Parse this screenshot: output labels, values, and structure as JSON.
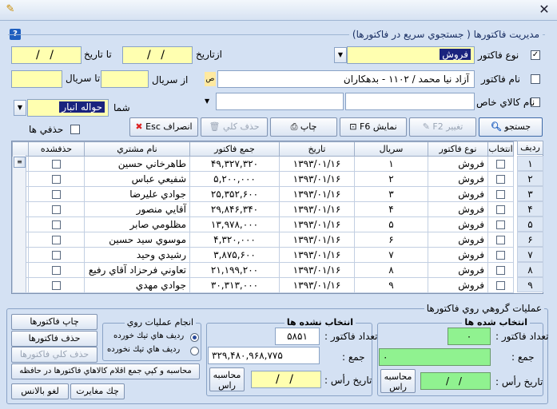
{
  "window": {
    "close_glyph": "✕"
  },
  "filter": {
    "group_title": "مديريت فاكتورها ( جستجوي سريع در فاكتورها)",
    "invoice_type_label": "نوع فاكتور",
    "invoice_type_value": "فروش",
    "invoice_type_checked": true,
    "from_date_label": "ازتاريخ",
    "to_date_label": "تا تاريخ",
    "from_date_value": "/ /",
    "to_date_value": "/ /",
    "customer_name_label": "نام فاكتور",
    "customer_name_value": "آزاد نيا محمد / ۱۱۰۲ - بدهكاران",
    "from_serial_label": "از سريال",
    "to_serial_label": "تا سريال",
    "special_goods_label": "نام كالاي خاص",
    "shipping_label": "شما",
    "shipping_value": "حواله انبار",
    "deleted_label": "حذفي ها"
  },
  "toolbar": {
    "search": "جستجو",
    "edit": "تغيير F2",
    "show": "نمايش F6",
    "print": "چاپ",
    "delete_all": "حذف كلي",
    "cancel": "انصراف Esc"
  },
  "grid": {
    "columns": [
      "رديف",
      "انتخاب",
      "نوع فاكتور",
      "سريال",
      "تاريخ",
      "جمع فاكتور",
      "نام مشتري",
      "حذفشده"
    ],
    "rows": [
      {
        "row": "۱",
        "type": "فروش",
        "serial": "۱",
        "date": "۱۳۹۳/۰۱/۱۶",
        "total": "۴۹,۳۲۷,۳۲۰",
        "customer": "طاهرخاني حسين"
      },
      {
        "row": "۲",
        "type": "فروش",
        "serial": "۲",
        "date": "۱۳۹۳/۰۱/۱۶",
        "total": "۵,۲۰۰,۰۰۰",
        "customer": "شفيعي عباس"
      },
      {
        "row": "۳",
        "type": "فروش",
        "serial": "۳",
        "date": "۱۳۹۳/۰۱/۱۶",
        "total": "۲۵,۳۵۲,۶۰۰",
        "customer": "جوادي عليرضا"
      },
      {
        "row": "۴",
        "type": "فروش",
        "serial": "۴",
        "date": "۱۳۹۳/۰۱/۱۶",
        "total": "۲۹,۸۴۶,۳۴۰",
        "customer": "آقايي منصور"
      },
      {
        "row": "۵",
        "type": "فروش",
        "serial": "۵",
        "date": "۱۳۹۳/۰۱/۱۶",
        "total": "۱۳,۹۷۸,۰۰۰",
        "customer": "مظلومي صابر"
      },
      {
        "row": "۶",
        "type": "فروش",
        "serial": "۶",
        "date": "۱۳۹۳/۰۱/۱۶",
        "total": "۴,۳۲۰,۰۰۰",
        "customer": "موسوي سيد حسين"
      },
      {
        "row": "۷",
        "type": "فروش",
        "serial": "۷",
        "date": "۱۳۹۳/۰۱/۱۶",
        "total": "۳,۸۷۵,۶۰۰",
        "customer": "رشيدي وحيد"
      },
      {
        "row": "۸",
        "type": "فروش",
        "serial": "۸",
        "date": "۱۳۹۳/۰۱/۱۶",
        "total": "۲۱,۱۹۹,۲۰۰",
        "customer": "تعاوني فرحزاد آقاي رفيع"
      },
      {
        "row": "۹",
        "type": "فروش",
        "serial": "۹",
        "date": "۱۳۹۳/۰۱/۱۶",
        "total": "۳۰,۳۱۳,۰۰۰",
        "customer": "جوادي مهدي"
      }
    ]
  },
  "group_ops": {
    "title": "عمليات گروهي روي فاكتورها",
    "selected_title": "انتخاب شده ها",
    "unselected_title": "انتخاب نشده ها",
    "count_label": "تعداد فاكتور :",
    "sum_label": "جمع :",
    "due_date_label": "تاريخ رأس :",
    "calc_due": "محاسبه راس",
    "selected_count": "۰",
    "selected_sum": "۰",
    "unselected_count": "۵۸۵۱",
    "unselected_sum": "۳۲۹,۴۸۰,۹۶۸,۷۷۵",
    "date_value": "/ /",
    "apply_title": "انجام عمليات روي",
    "radio_selected": "رديف هاي تيك خورده",
    "radio_unselected": "رديف هاي تيك نخورده",
    "print_invoices": "چاپ فاكتورها",
    "delete_invoices": "حذف فاكتورها",
    "delete_all_invoices": "حذف كلي فاكتورها",
    "copy_items": "محاسبه و كپي جمع اقلام كالاهاي فاكتورها در حافظه",
    "check_diff": "چك مغايرت",
    "cancel_balance": "لغو بالانس"
  }
}
